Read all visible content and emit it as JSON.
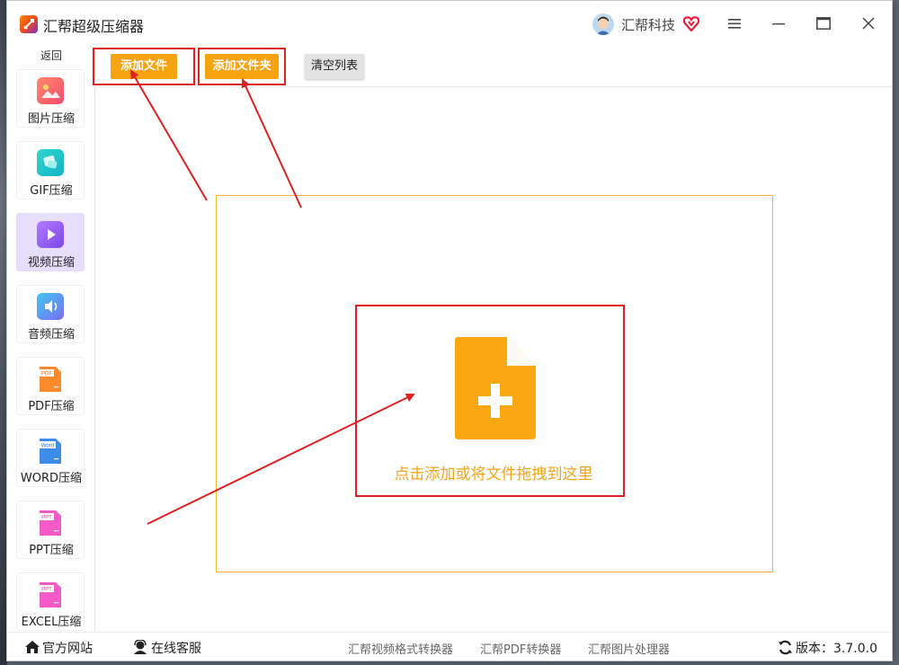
{
  "window": {
    "title": "汇帮超级压缩器"
  },
  "header": {
    "user_name": "汇帮科技",
    "icons": [
      "app-logo-icon",
      "user-avatar-icon",
      "vip-heart-icon",
      "menu-icon",
      "minimize-icon",
      "maximize-icon",
      "close-icon"
    ]
  },
  "sidebar": {
    "back_label": "返回",
    "items": [
      {
        "label": "图片压缩",
        "icon": "image-icon",
        "active": false
      },
      {
        "label": "GIF压缩",
        "icon": "gif-icon",
        "active": false
      },
      {
        "label": "视频压缩",
        "icon": "video-play-icon",
        "active": true
      },
      {
        "label": "音频压缩",
        "icon": "audio-icon",
        "active": false
      },
      {
        "label": "PDF压缩",
        "icon": "pdf-file-icon",
        "badge": "PDF",
        "active": false
      },
      {
        "label": "WORD压缩",
        "icon": "word-file-icon",
        "badge": "Word",
        "active": false
      },
      {
        "label": "PPT压缩",
        "icon": "ppt-file-icon",
        "badge": "PPT",
        "active": false
      },
      {
        "label": "EXCEL压缩",
        "icon": "excel-file-icon",
        "badge": "PPT",
        "active": false
      }
    ]
  },
  "toolbar": {
    "add_file_label": "添加文件",
    "add_folder_label": "添加文件夹",
    "clear_list_label": "清空列表"
  },
  "main": {
    "drop_hint": "点击添加或将文件拖拽到这里"
  },
  "footer": {
    "website_label": "官方网站",
    "support_label": "在线客服",
    "links": [
      "汇帮视频格式转换器",
      "汇帮PDF转换器",
      "汇帮图片处理器"
    ],
    "version_label": "版本：3.7.0.0"
  },
  "colors": {
    "accent_orange": "#f7a211",
    "drop_border": "#f7b234",
    "drop_text": "#f0a31c",
    "annotation_red": "#e02020",
    "active_sidebar": "#e6defa"
  }
}
